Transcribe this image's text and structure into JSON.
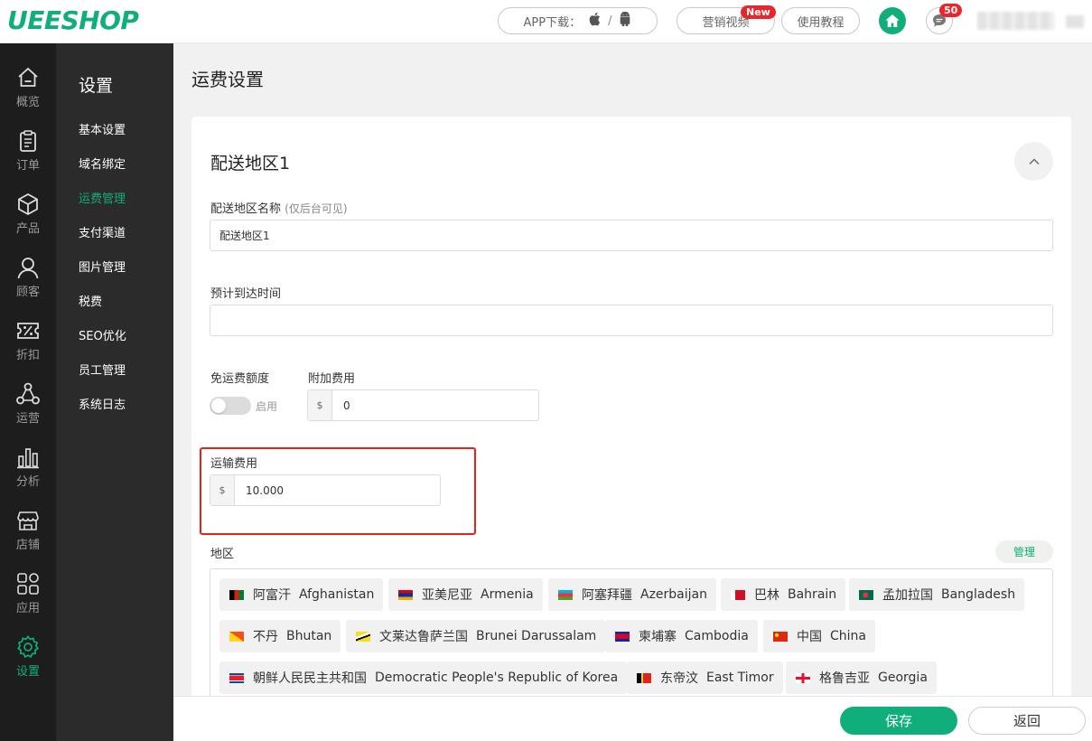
{
  "header": {
    "logo": "UEESHOP",
    "app_download_label": "APP下载：",
    "app_separator": "/",
    "video_label": "营销视频",
    "new_badge": "New",
    "tutorial_label": "使用教程",
    "message_count": "50",
    "accent_color": "#10ae7a"
  },
  "rail": {
    "items": [
      {
        "label": "概览",
        "icon": "home-outline-icon"
      },
      {
        "label": "订单",
        "icon": "clipboard-icon"
      },
      {
        "label": "产品",
        "icon": "box-icon"
      },
      {
        "label": "顾客",
        "icon": "user-icon"
      },
      {
        "label": "折扣",
        "icon": "ticket-percent-icon"
      },
      {
        "label": "运营",
        "icon": "share-nodes-icon"
      },
      {
        "label": "分析",
        "icon": "bar-chart-icon"
      },
      {
        "label": "店铺",
        "icon": "store-icon"
      },
      {
        "label": "应用",
        "icon": "apps-icon"
      },
      {
        "label": "设置",
        "icon": "gear-icon",
        "active": true
      }
    ]
  },
  "subnav": {
    "title": "设置",
    "items": [
      "基本设置",
      "域名绑定",
      "运费管理",
      "支付渠道",
      "图片管理",
      "税费",
      "SEO优化",
      "员工管理",
      "系统日志"
    ],
    "active_index": 2
  },
  "main": {
    "page_title": "运费设置",
    "card_title": "配送地区1",
    "zone_name_label": "配送地区名称",
    "zone_name_hint": "(仅后台可见)",
    "zone_name_value": "配送地区1",
    "eta_label": "预计到达时间",
    "eta_value": "",
    "free_threshold_label": "免运费额度",
    "toggle_label": "启用",
    "surcharge_label": "附加费用",
    "currency_symbol": "$",
    "surcharge_value": "0",
    "shipping_fee_label": "运输费用",
    "shipping_fee_value": "10.000",
    "region_label": "地区",
    "manage_label": "管理",
    "countries": [
      {
        "cn": "阿富汗",
        "en": "Afghanistan"
      },
      {
        "cn": "亚美尼亚",
        "en": "Armenia"
      },
      {
        "cn": "阿塞拜疆",
        "en": "Azerbaijan"
      },
      {
        "cn": "巴林",
        "en": "Bahrain"
      },
      {
        "cn": "孟加拉国",
        "en": "Bangladesh"
      },
      {
        "cn": "不丹",
        "en": "Bhutan"
      },
      {
        "cn": "文莱达鲁萨兰国",
        "en": "Brunei Darussalam"
      },
      {
        "cn": "柬埔寨",
        "en": "Cambodia"
      },
      {
        "cn": "中国",
        "en": "China"
      },
      {
        "cn": "朝鲜人民民主共和国",
        "en": "Democratic People's Republic of Korea"
      },
      {
        "cn": "东帝汶",
        "en": "East Timor"
      },
      {
        "cn": "格鲁吉亚",
        "en": "Georgia"
      }
    ]
  },
  "footer": {
    "save_label": "保存",
    "back_label": "返回"
  }
}
